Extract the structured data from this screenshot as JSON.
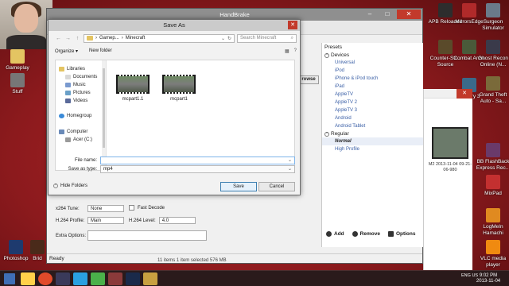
{
  "desktop_left": {
    "gameplay_label": "Gameplay",
    "stuff_label": "Stuff",
    "photoshop_label": "Photoshop",
    "bridge_label": "Brid"
  },
  "desktop_right": [
    {
      "label": "APB Reloaded",
      "color": "#2d2d2d"
    },
    {
      "label": "MirrorsEdge",
      "color": "#b02a2a"
    },
    {
      "label": "Surgeon Simulator",
      "color": "#6a7a8a"
    },
    {
      "label": "Counter-Str... Source",
      "color": "#5a4a2a"
    },
    {
      "label": "Combat Arms",
      "color": "#4a5a3a"
    },
    {
      "label": "Ghost Recon Online (N...",
      "color": "#3a3a4a"
    },
    {
      "label": "Far Cry 3",
      "color": "#3a6a8a"
    },
    {
      "label": "Grand Theft Auto - Sa...",
      "color": "#7a6a3a"
    },
    {
      "label": "BB FlashBack Express Rec...",
      "color": "#6a3a6a"
    },
    {
      "label": "MixPad",
      "color": "#c33030"
    },
    {
      "label": "LogMeIn Hamachi",
      "color": "#e08a20"
    },
    {
      "label": "VLC media player",
      "color": "#f08a10"
    }
  ],
  "handbrake": {
    "title": "HandBrake",
    "browse_label": "rowse",
    "presets_title": "Presets",
    "group_devices": "Devices",
    "devices": [
      "Universal",
      "iPod",
      "iPhone & iPod touch",
      "iPad",
      "AppleTV",
      "AppleTV 2",
      "AppleTV 3",
      "Android",
      "Android Tablet"
    ],
    "group_regular": "Regular",
    "regular": [
      "Normal",
      "High Profile"
    ],
    "selected_preset": "Normal",
    "add_label": "Add",
    "remove_label": "Remove",
    "options_label": "Options",
    "status": "Ready",
    "x264_tune_label": "x264 Tune:",
    "x264_tune_value": "None",
    "fast_decode_label": "Fast Decode",
    "h264_profile_label": "H.264 Profile:",
    "h264_profile_value": "Main",
    "h264_level_label": "H.264 Level:",
    "h264_level_value": "4.0",
    "extra_options_label": "Extra Options:",
    "extra_options_value": ""
  },
  "explorer": {
    "file_caption": "M2 2013-11-04 09-21-06-980",
    "status": "11 items    1 item selected  576 MB"
  },
  "dialog": {
    "title": "Save As",
    "breadcrumb": [
      "Gamep...",
      "Minecraft"
    ],
    "search_placeholder": "Search Minecraft",
    "organize_label": "Organize",
    "new_folder_label": "New folder",
    "nav": [
      "Libraries",
      "Documents",
      "Music",
      "Pictures",
      "Videos",
      "Homegroup",
      "Computer",
      "Acer (C:)"
    ],
    "files": [
      "mcpart1.1",
      "mcpart1"
    ],
    "file_name_label": "File name:",
    "file_name_value": "",
    "save_type_label": "Save as type:",
    "save_type_value": "mp4",
    "hide_folders_label": "Hide Folders",
    "save_label": "Save",
    "cancel_label": "Cancel"
  },
  "taskbar": {
    "time": "9:02 PM",
    "date": "2013-11-04",
    "lang": "ENG US"
  }
}
